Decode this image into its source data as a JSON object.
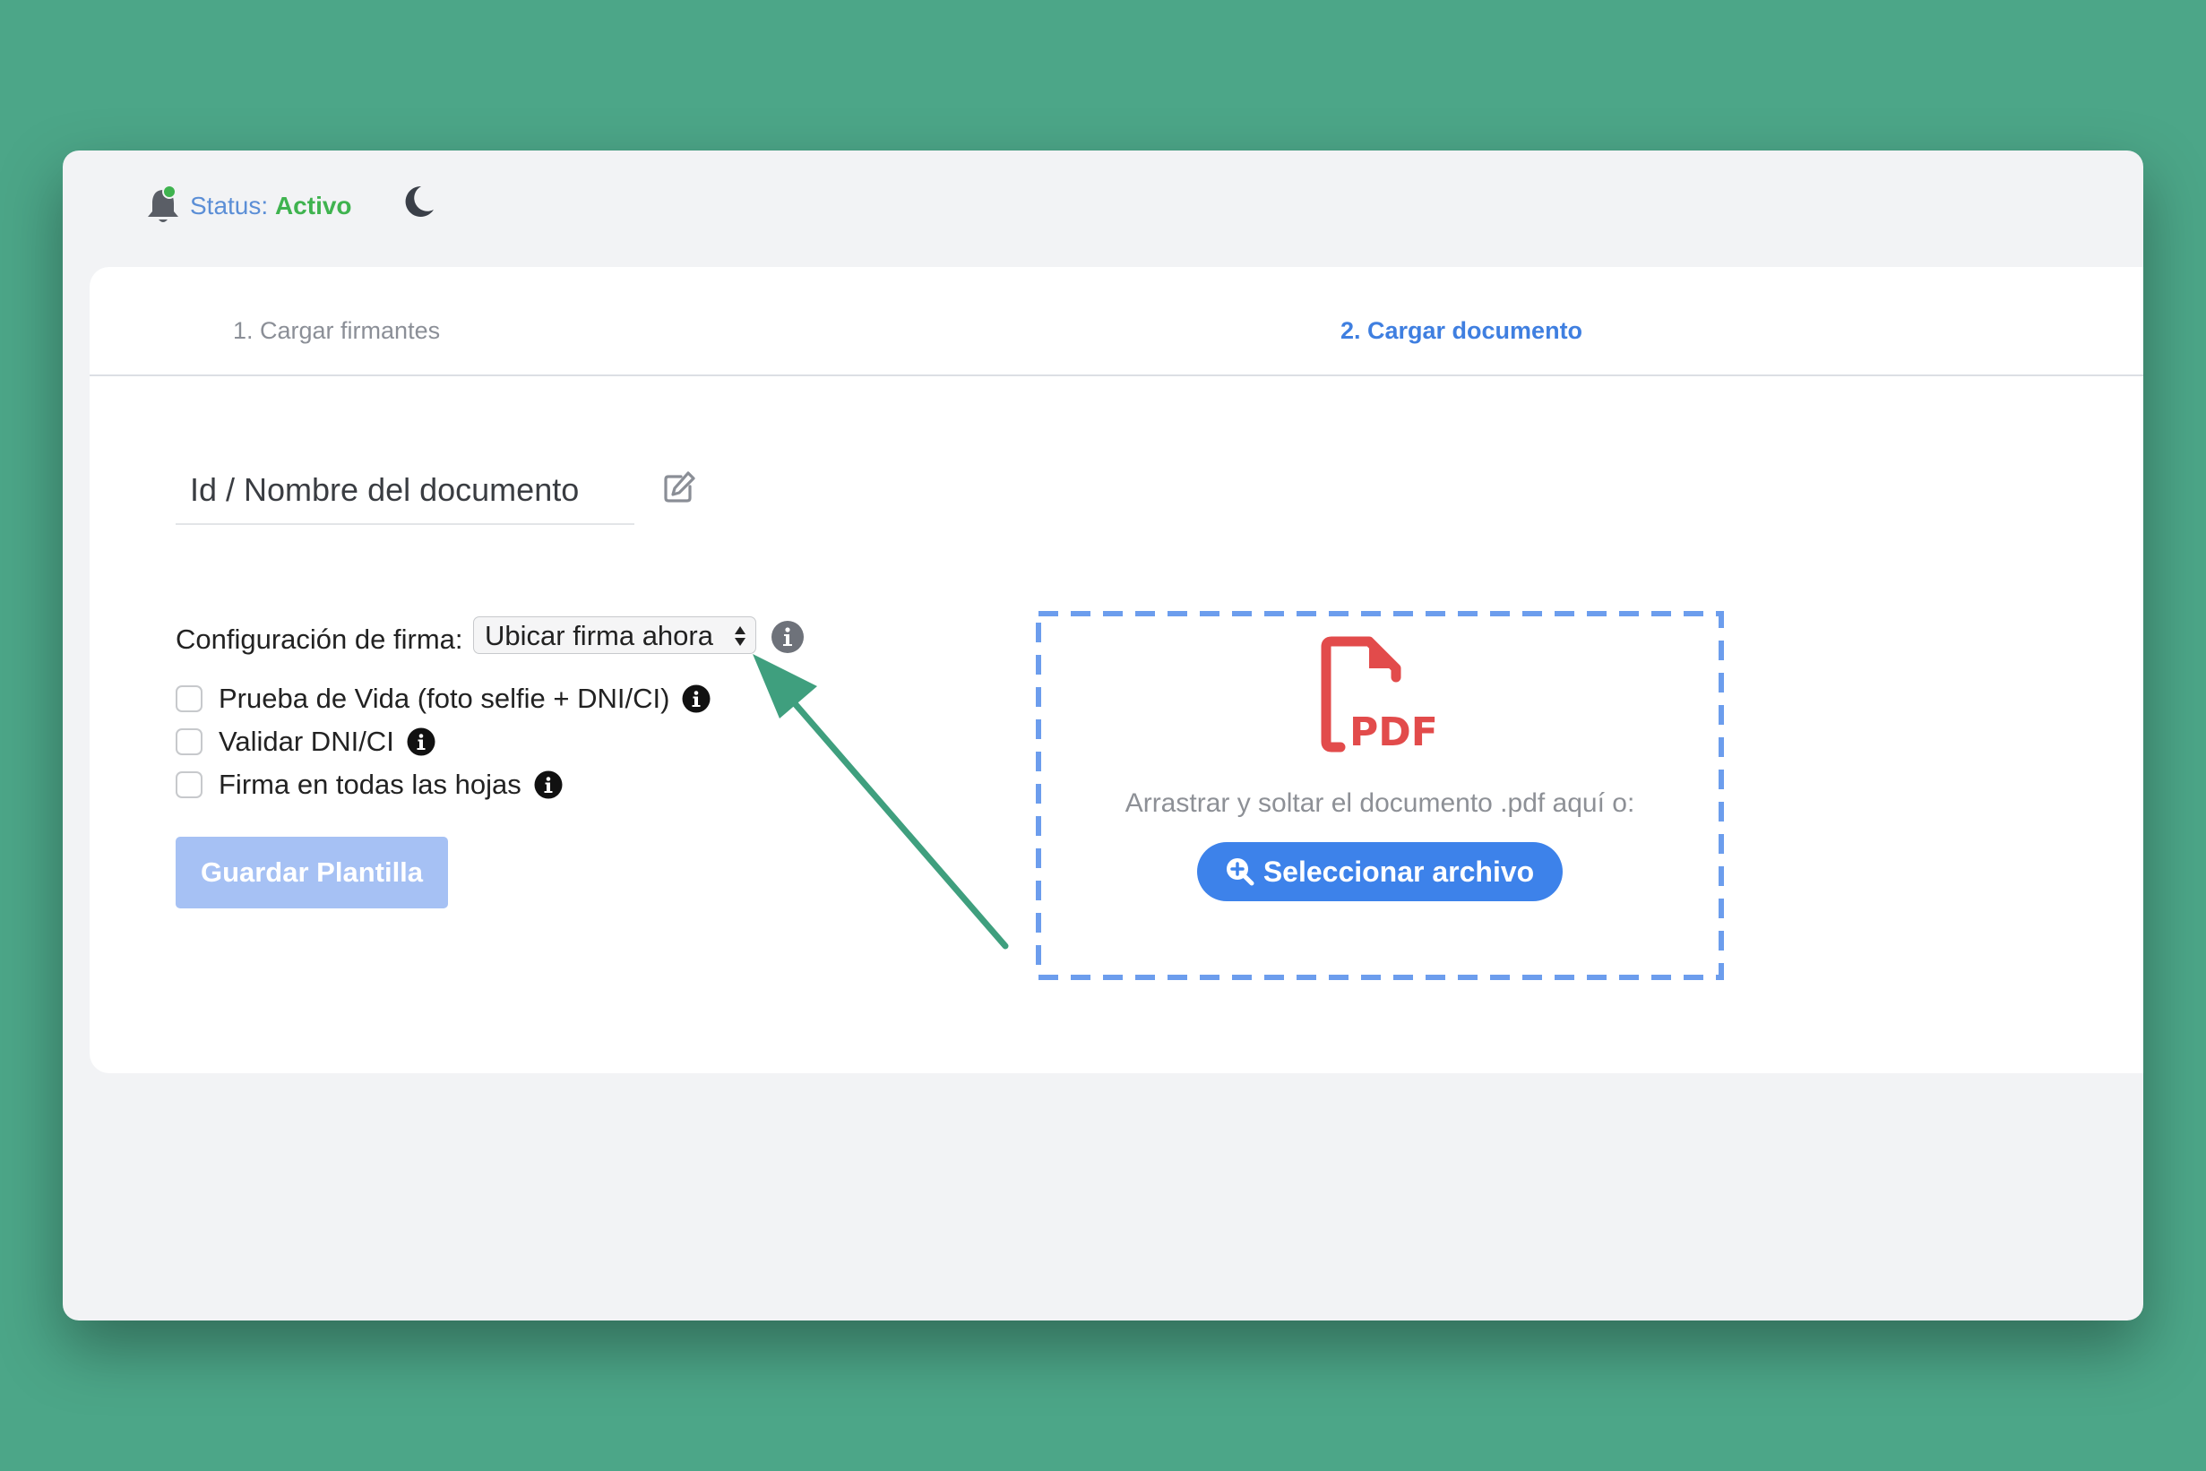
{
  "status": {
    "label": "Status:",
    "value": "Activo",
    "value_color": "#3fb34f"
  },
  "tabs": [
    {
      "label": "1. Cargar firmantes",
      "active": false
    },
    {
      "label": "2. Cargar documento",
      "active": true
    }
  ],
  "document_name": {
    "placeholder": "Id / Nombre del documento",
    "value": ""
  },
  "signature_config": {
    "label": "Configuración de firma:",
    "selected": "Ubicar firma ahora"
  },
  "options": [
    {
      "label": "Prueba de Vida (foto selfie + DNI/CI)",
      "checked": false
    },
    {
      "label": "Validar DNI/CI",
      "checked": false
    },
    {
      "label": "Firma en todas las hojas",
      "checked": false
    }
  ],
  "save_button": {
    "label": "Guardar Plantilla",
    "disabled": true
  },
  "dropzone": {
    "text": "Arrastrar y soltar el documento .pdf aquí o:",
    "button_label": "Seleccionar archivo",
    "icon": "pdf-file-icon"
  },
  "colors": {
    "background": "#4ca688",
    "accent": "#3d82ea",
    "pdf_red": "#e24b4b",
    "annotation_arrow": "#3f9f7e"
  }
}
